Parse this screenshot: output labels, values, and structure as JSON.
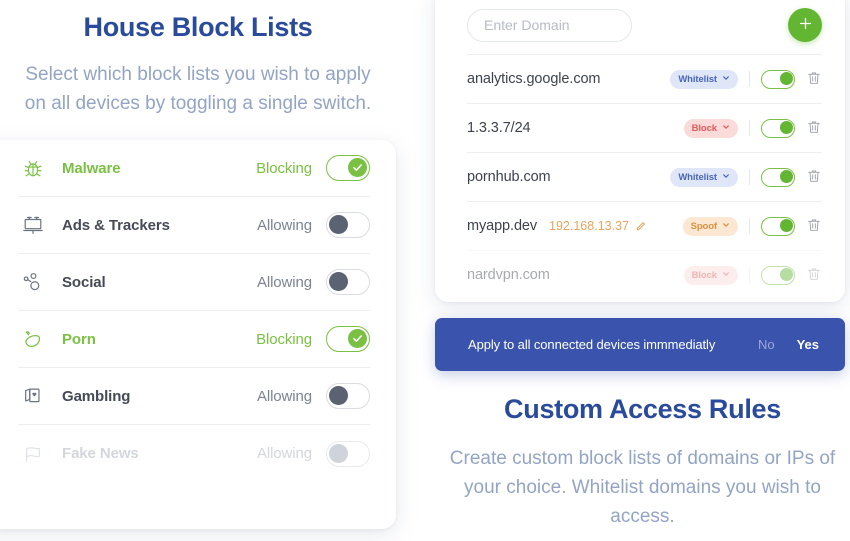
{
  "left": {
    "title": "House Block Lists",
    "subtitle": "Select which block lists you wish to apply on all devices by toggling a single switch.",
    "items": [
      {
        "icon": "bug-icon",
        "label": "Malware",
        "status": "Blocking",
        "on": true
      },
      {
        "icon": "billboard-icon",
        "label": "Ads & Trackers",
        "status": "Allowing",
        "on": false
      },
      {
        "icon": "share-icon",
        "label": "Social",
        "status": "Allowing",
        "on": false
      },
      {
        "icon": "eggplant-icon",
        "label": "Porn",
        "status": "Blocking",
        "on": true
      },
      {
        "icon": "cards-icon",
        "label": "Gambling",
        "status": "Allowing",
        "on": false
      },
      {
        "icon": "flag-icon",
        "label": "Fake News",
        "status": "Allowing",
        "on": false
      }
    ]
  },
  "right": {
    "input_placeholder": "Enter Domain",
    "input_value": "",
    "add_label": "+",
    "rows": [
      {
        "domain": "analytics.google.com",
        "ip": "",
        "badge": "Whitelist",
        "badge_type": "whitelist",
        "enabled": true
      },
      {
        "domain": "1.3.3.7/24",
        "ip": "",
        "badge": "Block",
        "badge_type": "block",
        "enabled": true
      },
      {
        "domain": "pornhub.com",
        "ip": "",
        "badge": "Whitelist",
        "badge_type": "whitelist",
        "enabled": true
      },
      {
        "domain": "myapp.dev",
        "ip": "192.168.13.37",
        "badge": "Spoof",
        "badge_type": "spoof",
        "enabled": true
      },
      {
        "domain": "nardvpn.com",
        "ip": "",
        "badge": "Block",
        "badge_type": "block",
        "enabled": true
      }
    ],
    "banner": {
      "message": "Apply to all connected devices immmediatly",
      "no_label": "No",
      "yes_label": "Yes"
    },
    "title": "Custom Access Rules",
    "subtitle": "Create custom block lists of domains or IPs of your choice. Whitelist domains you wish to access."
  },
  "colors": {
    "brand_blue": "#2a4a9c",
    "accent_green": "#7ac143",
    "banner_blue": "#3a53ac",
    "muted_text": "#93a4c4"
  }
}
